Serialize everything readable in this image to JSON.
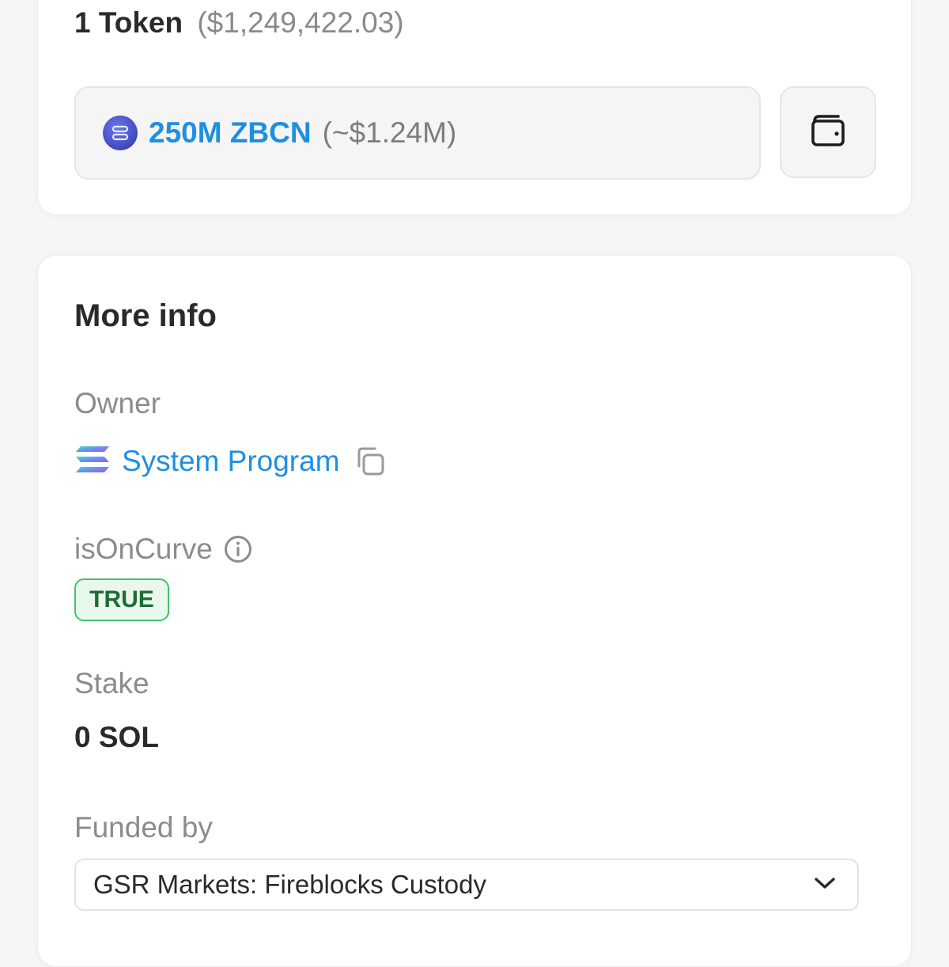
{
  "holdings": {
    "token_count": "1 Token",
    "token_usd": "($1,249,422.03)",
    "token": {
      "amount": "250M ZBCN",
      "usd": "(~$1.24M)",
      "logo_icon": "zbcn-token-icon"
    },
    "wallet_icon": "wallet-icon"
  },
  "more_info": {
    "title": "More info",
    "owner": {
      "label": "Owner",
      "value": "System Program",
      "icon": "solana-icon",
      "copy_icon": "copy-icon"
    },
    "is_on_curve": {
      "label": "isOnCurve",
      "info_icon": "info-icon",
      "badge": "TRUE"
    },
    "stake": {
      "label": "Stake",
      "value": "0 SOL"
    },
    "funded_by": {
      "label": "Funded by",
      "selected": "GSR Markets: Fireblocks Custody",
      "dropdown_icon": "chevron-down-icon"
    }
  },
  "colors": {
    "link": "#1f8fe0",
    "badge_bg": "#e9f8ec",
    "badge_border": "#3fc26a",
    "badge_text": "#1e6b35",
    "page_bg": "#f6f6f7"
  }
}
